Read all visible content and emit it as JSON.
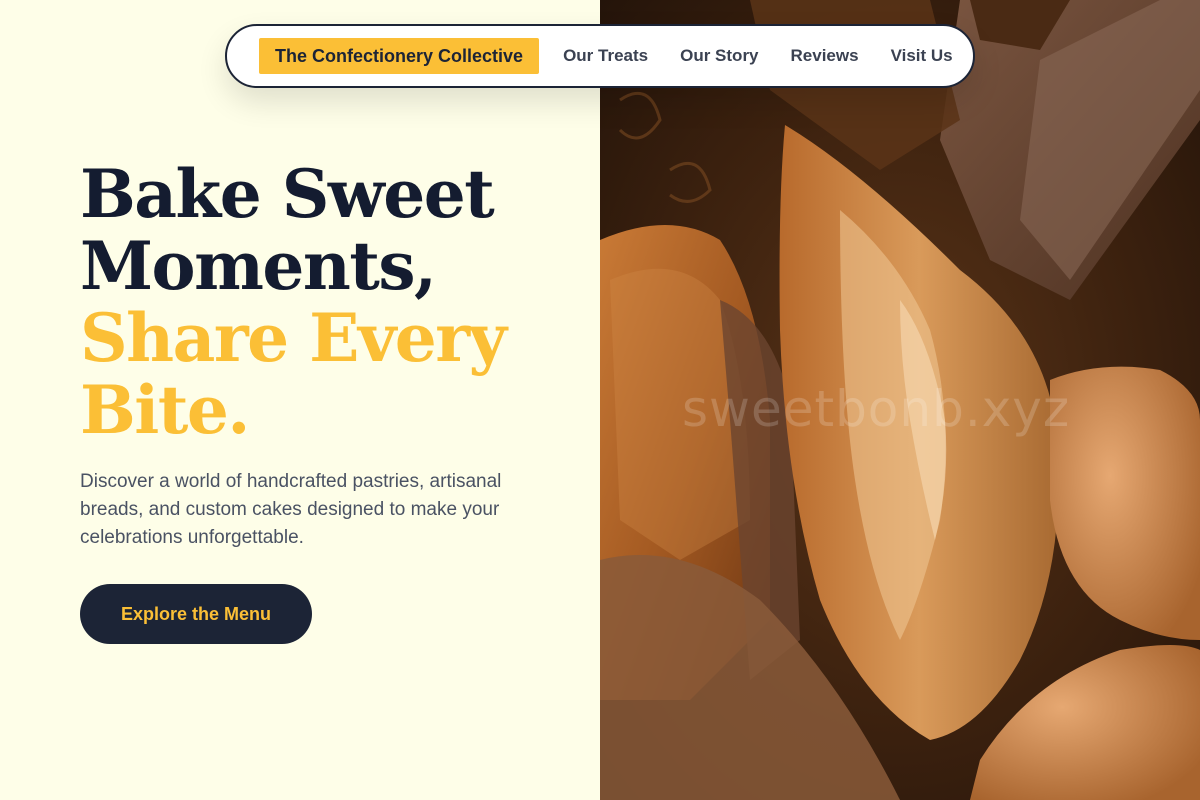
{
  "nav": {
    "brand": "The Confectionery Collective",
    "links": [
      "Our Treats",
      "Our Story",
      "Reviews",
      "Visit Us"
    ]
  },
  "hero": {
    "headline_lines": [
      "Bake Sweet",
      "Moments,"
    ],
    "accent_lines": [
      "Share Every",
      "Bite."
    ],
    "description": "Discover a world of handcrafted pastries, artisanal breads, and custom cakes designed to make your celebrations unforgettable.",
    "cta_label": "Explore the Menu"
  },
  "image": {
    "watermark": "sweetbonb.xyz"
  },
  "colors": {
    "background": "#fefee8",
    "accent": "#fbbf36",
    "dark": "#1c2436",
    "body_text": "#4a5263"
  }
}
